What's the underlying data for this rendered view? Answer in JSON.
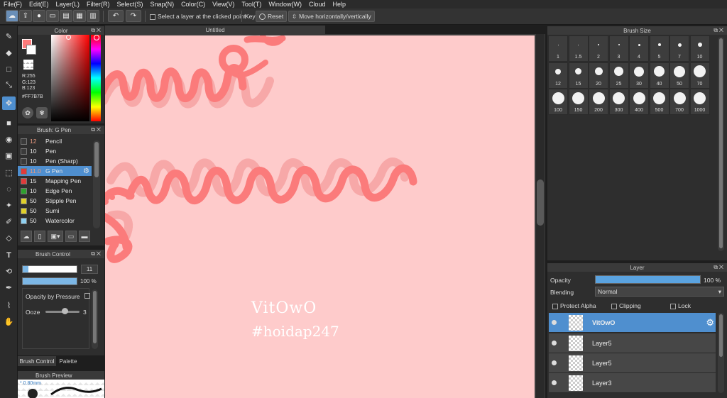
{
  "menu": [
    "File(F)",
    "Edit(E)",
    "Layer(L)",
    "Filter(R)",
    "Select(S)",
    "Snap(N)",
    "Color(C)",
    "View(V)",
    "Tool(T)",
    "Window(W)",
    "Cloud",
    "Help"
  ],
  "toolbar": {
    "select_layer_label": "Select a layer at the clicked point",
    "key_label": "Key",
    "reset_label": "Reset",
    "move_label": "Move horizontally/vertically"
  },
  "color_panel": {
    "title": "Color",
    "r": "R:255",
    "g": "G:123",
    "b": "B:123",
    "hex": "#FF7B7B",
    "fg_color": "#ff7b7b"
  },
  "brush_panel": {
    "title": "Brush: G Pen",
    "items": [
      {
        "size": "12",
        "name": "Pencil",
        "color": "#3a3a3a"
      },
      {
        "size": "10",
        "name": "Pen",
        "color": "#3a3a3a"
      },
      {
        "size": "10",
        "name": "Pen (Sharp)",
        "color": "#3a3a3a"
      },
      {
        "size": "11.0",
        "name": "G Pen",
        "color": "#e03a3a"
      },
      {
        "size": "15",
        "name": "Mapping Pen",
        "color": "#e03a3a"
      },
      {
        "size": "10",
        "name": "Edge Pen",
        "color": "#2ea02e"
      },
      {
        "size": "50",
        "name": "Stipple Pen",
        "color": "#e0d02a"
      },
      {
        "size": "50",
        "name": "Sumi",
        "color": "#e0d02a"
      },
      {
        "size": "50",
        "name": "Watercolor",
        "color": "#8fd0f0"
      }
    ]
  },
  "brush_control": {
    "title": "Brush Control",
    "size_value": "11",
    "size_fill": 0.1,
    "opacity_value": "100 %",
    "opacity_by_pressure_label": "Opacity by Pressure",
    "ooze_label": "Ooze",
    "ooze_value": "3",
    "tab_brush_control": "Brush Control",
    "tab_palette": "Palette"
  },
  "brush_preview": {
    "title": "Brush Preview",
    "size_label": "* 0.80mm"
  },
  "canvas": {
    "tab_title": "Untitled",
    "text_line1": "VitOwO",
    "text_line2": "#hoidap247",
    "bg_color": "#fecbcb",
    "stroke_color": "#fb7b7b"
  },
  "brush_size_panel": {
    "title": "Brush Size",
    "sizes": [
      "1",
      "1.5",
      "2",
      "3",
      "4",
      "5",
      "7",
      "10",
      "12",
      "15",
      "20",
      "25",
      "30",
      "40",
      "50",
      "70",
      "100",
      "150",
      "200",
      "300",
      "400",
      "500",
      "700",
      "1000"
    ]
  },
  "layer_panel": {
    "title": "Layer",
    "opacity_label": "Opacity",
    "opacity_value": "100 %",
    "blending_label": "Blending",
    "blending_value": "Normal",
    "protect_alpha_label": "Protect Alpha",
    "clipping_label": "Clipping",
    "lock_label": "Lock",
    "layers": [
      {
        "name": "VitOwO",
        "selected": true
      },
      {
        "name": "Layer5",
        "selected": false
      },
      {
        "name": "Layer5",
        "selected": false
      },
      {
        "name": "Layer3",
        "selected": false
      }
    ]
  }
}
